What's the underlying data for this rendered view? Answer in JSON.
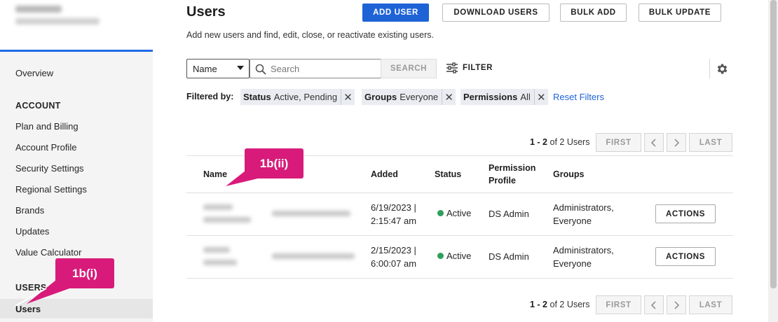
{
  "sidebar": {
    "overview": "Overview",
    "account_heading": "ACCOUNT",
    "account_items": [
      "Plan and Billing",
      "Account Profile",
      "Security Settings",
      "Regional Settings",
      "Brands",
      "Updates",
      "Value Calculator"
    ],
    "users_heading": "USERS A",
    "active_item": "Users"
  },
  "header": {
    "title": "Users",
    "subtitle": "Add new users and find, edit, close, or reactivate existing users.",
    "buttons": {
      "add_user": "ADD USER",
      "download_users": "DOWNLOAD USERS",
      "bulk_add": "BULK ADD",
      "bulk_update": "BULK UPDATE"
    },
    "accent_color": "#1e63d6"
  },
  "search": {
    "field_select": "Name",
    "placeholder": "Search",
    "search_button": "SEARCH",
    "filter_button": "FILTER"
  },
  "filters": {
    "label": "Filtered by:",
    "chips": [
      {
        "key": "Status",
        "value": "Active, Pending"
      },
      {
        "key": "Groups",
        "value": "Everyone"
      },
      {
        "key": "Permissions",
        "value": "All"
      }
    ],
    "reset": "Reset Filters"
  },
  "pagination": {
    "range": "1 - 2",
    "of_text": "of 2 Users",
    "first": "FIRST",
    "last": "LAST"
  },
  "table": {
    "columns": {
      "name": "Name",
      "added": "Added",
      "status": "Status",
      "permission_line1": "Permission",
      "permission_line2": "Profile",
      "groups": "Groups"
    },
    "rows": [
      {
        "added_date": "6/19/2023 |",
        "added_time": "2:15:47 am",
        "status": "Active",
        "permission": "DS Admin",
        "groups_line1": "Administrators,",
        "groups_line2": "Everyone",
        "action": "ACTIONS"
      },
      {
        "added_date": "2/15/2023 |",
        "added_time": "6:00:07 am",
        "status": "Active",
        "permission": "DS Admin",
        "groups_line1": "Administrators,",
        "groups_line2": "Everyone",
        "action": "ACTIONS"
      }
    ],
    "status_color": "#2e9e5b"
  },
  "callouts": {
    "one": "1b(ii)",
    "two": "1b(i)",
    "color": "#d81b7a"
  }
}
